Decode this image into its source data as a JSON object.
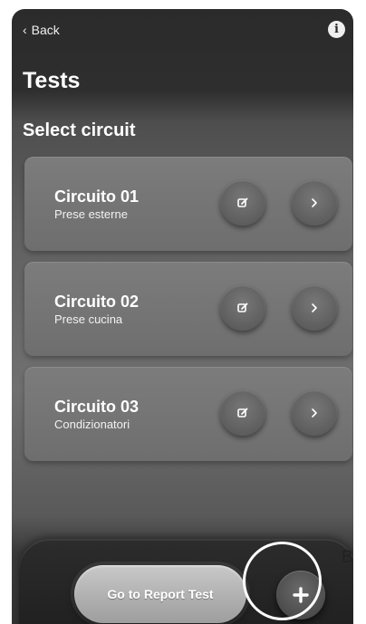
{
  "header": {
    "back_label": "Back",
    "back_icon": "chevron-left",
    "info_glyph": "i",
    "info_icon": "info"
  },
  "page": {
    "title": "Tests",
    "section_title": "Select circuit"
  },
  "circuits": [
    {
      "name": "Circuito 01",
      "description": "Prese esterne"
    },
    {
      "name": "Circuito 02",
      "description": "Prese cucina"
    },
    {
      "name": "Circuito 03",
      "description": "Condizionatori"
    }
  ],
  "circuit_actions": {
    "edit_icon": "edit-pencil",
    "open_icon": "chevron-right"
  },
  "bottom_bar": {
    "report_button_label": "Go to Report Test",
    "add_icon": "plus"
  },
  "annotation": {
    "label": "B"
  },
  "colors": {
    "screen_dark": "#2b2b2b",
    "card": "#7c7c7c",
    "button": "#5e5e5e",
    "report_button": "#b0b0b0",
    "highlight_ring": "#ffffff"
  }
}
